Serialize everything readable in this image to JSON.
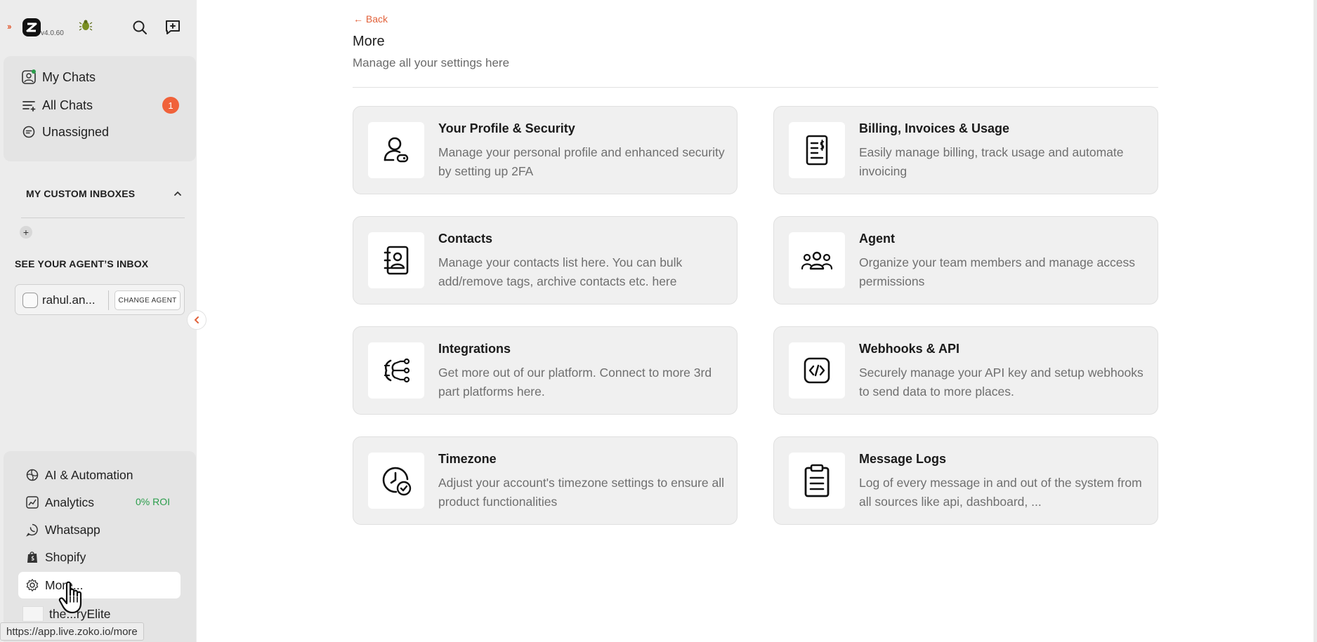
{
  "app": {
    "version": "v4.0.60"
  },
  "sidebar": {
    "nav": [
      {
        "label": "My Chats"
      },
      {
        "label": "All Chats",
        "badge": "1"
      },
      {
        "label": "Unassigned"
      }
    ],
    "custom_inboxes_title": "MY CUSTOM INBOXES",
    "agent_inbox_title": "SEE YOUR AGENT’S INBOX",
    "agent": {
      "name": "rahul.an...",
      "change_label": "CHANGE AGENT"
    },
    "bottom_nav": [
      {
        "label": "AI & Automation"
      },
      {
        "label": "Analytics",
        "extra": "0% ROI"
      },
      {
        "label": "Whatsapp"
      },
      {
        "label": "Shopify"
      },
      {
        "label": "More..."
      }
    ],
    "store_name": "the...ryElite",
    "status_url": "https://app.live.zoko.io/more"
  },
  "main": {
    "back_label": "← Back",
    "title": "More",
    "subtitle": "Manage all your settings here",
    "cards": [
      {
        "title": "Your Profile & Security",
        "desc": "Manage your personal profile and enhanced security by setting up 2FA",
        "icon": "profile-security-icon"
      },
      {
        "title": "Billing, Invoices & Usage",
        "desc": "Easily manage billing, track usage and automate invoicing",
        "icon": "billing-invoice-icon"
      },
      {
        "title": "Contacts",
        "desc": "Manage your contacts list here. You can bulk add/remove tags, archive contacts etc. here",
        "icon": "contacts-book-icon"
      },
      {
        "title": "Agent",
        "desc": "Organize your team members and manage access permissions",
        "icon": "team-agents-icon"
      },
      {
        "title": "Integrations",
        "desc": "Get more out of our platform. Connect to more 3rd part platforms here.",
        "icon": "integrations-icon"
      },
      {
        "title": "Webhooks & API",
        "desc": "Securely manage your API key and setup webhooks to send data to more places.",
        "icon": "code-brackets-icon"
      },
      {
        "title": "Timezone",
        "desc": "Adjust your account's timezone settings to ensure all product functionalities",
        "icon": "clock-check-icon"
      },
      {
        "title": "Message Logs",
        "desc": "Log of every message in and out of the system from all sources like api, dashboard, ...",
        "icon": "clipboard-log-icon"
      }
    ]
  },
  "colors": {
    "accent": "#e2623b",
    "badge": "#f0623a",
    "roi_green": "#2a9d4b",
    "online_dot": "#2a9d4b"
  }
}
